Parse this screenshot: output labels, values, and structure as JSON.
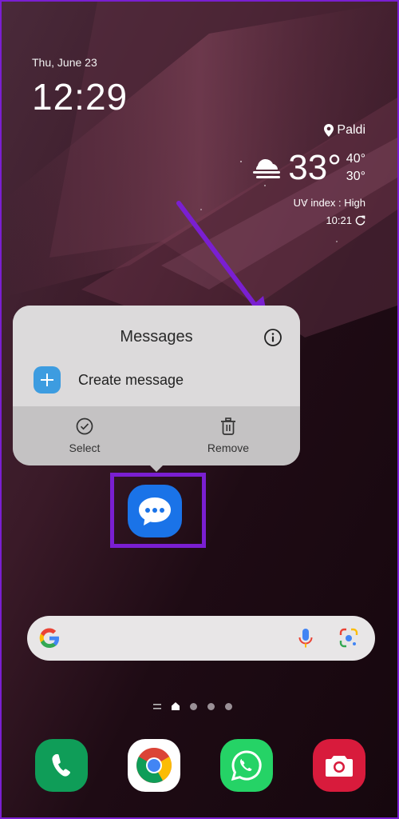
{
  "status": {
    "date": "Thu, June 23",
    "time": "12:29"
  },
  "weather": {
    "location": "Paldi",
    "temperature": "33°",
    "high": "40°",
    "low": "30°",
    "uv_index": "UV index : High",
    "updated_time": "10:21",
    "icon": "cloudy-weather-icon"
  },
  "popup": {
    "title": "Messages",
    "create_label": "Create message",
    "actions": [
      {
        "label": "Select",
        "icon": "check-circle-icon"
      },
      {
        "label": "Remove",
        "icon": "trash-icon"
      }
    ]
  },
  "search_bar": {
    "icons": [
      "google-logo-icon",
      "microphone-icon",
      "google-lens-icon"
    ]
  },
  "page_indicator": {
    "pages": 4,
    "current": 0
  },
  "dock": {
    "apps": [
      "phone",
      "chrome",
      "whatsapp",
      "camera"
    ]
  },
  "colors": {
    "highlight": "#7a1fd1",
    "messages_blue": "#1a73e8",
    "popup_bg": "#dcdadb",
    "popup_footer": "#c4c2c3"
  }
}
